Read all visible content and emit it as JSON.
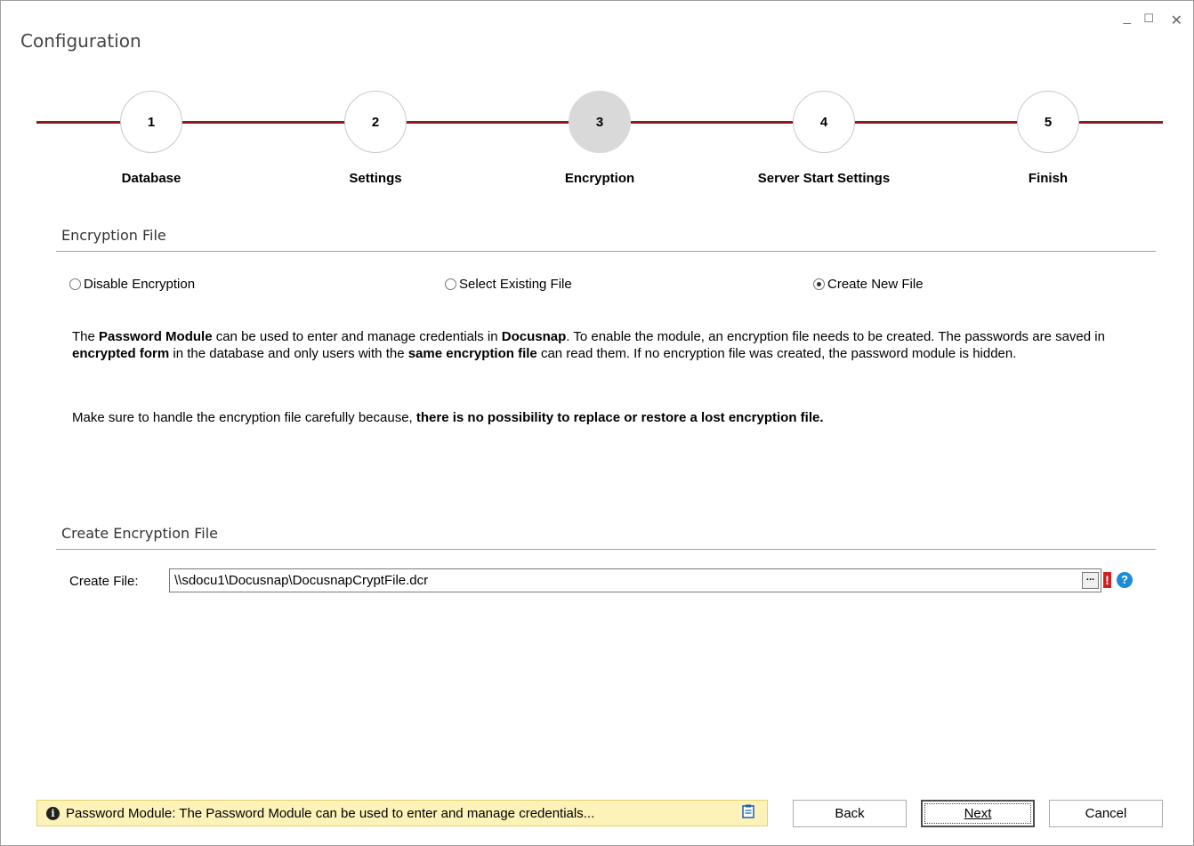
{
  "window": {
    "title": "Configuration",
    "controls": {
      "minimize": "_",
      "maximize": "☐",
      "close": "✕"
    }
  },
  "stepper": {
    "active_step": 3,
    "steps": [
      {
        "number": "1",
        "label": "Database"
      },
      {
        "number": "2",
        "label": "Settings"
      },
      {
        "number": "3",
        "label": "Encryption"
      },
      {
        "number": "4",
        "label": "Server Start Settings"
      },
      {
        "number": "5",
        "label": "Finish"
      }
    ],
    "line_color": "#8c1a1f"
  },
  "encryption_section": {
    "title": "Encryption File",
    "options": [
      {
        "label": "Disable Encryption",
        "checked": false
      },
      {
        "label": "Select Existing File",
        "checked": false
      },
      {
        "label": "Create New File",
        "checked": true
      }
    ],
    "description_p1": [
      {
        "text": "The ",
        "bold": false
      },
      {
        "text": "Password Module",
        "bold": true
      },
      {
        "text": " can be used to enter and manage credentials in ",
        "bold": false
      },
      {
        "text": "Docusnap",
        "bold": true
      },
      {
        "text": ". To enable the module, an encryption file needs to be created. The passwords are saved in ",
        "bold": false
      },
      {
        "text": "encrypted form",
        "bold": true
      },
      {
        "text": " in the database and only users with the ",
        "bold": false
      },
      {
        "text": "same encryption file",
        "bold": true
      },
      {
        "text": " can read them. If no encryption file was created, the password module is hidden.",
        "bold": false
      }
    ],
    "description_p2": [
      {
        "text": "Make sure to handle the encryption file carefully because, ",
        "bold": false
      },
      {
        "text": "there is no possibility to replace or restore a lost encryption file.",
        "bold": true
      }
    ]
  },
  "create_section": {
    "title": "Create Encryption File",
    "field_label": "Create File:",
    "file_path": "\\\\sdocu1\\Docusnap\\DocusnapCryptFile.dcr",
    "browse_label": "...",
    "error_icon": "!",
    "help_icon": "?"
  },
  "status": {
    "info_icon": "i",
    "message": "Password Module: The Password Module can be used to enter and manage credentials...",
    "copy_icon": "clipboard-icon"
  },
  "buttons": {
    "back": "Back",
    "next": "Next",
    "cancel": "Cancel"
  }
}
